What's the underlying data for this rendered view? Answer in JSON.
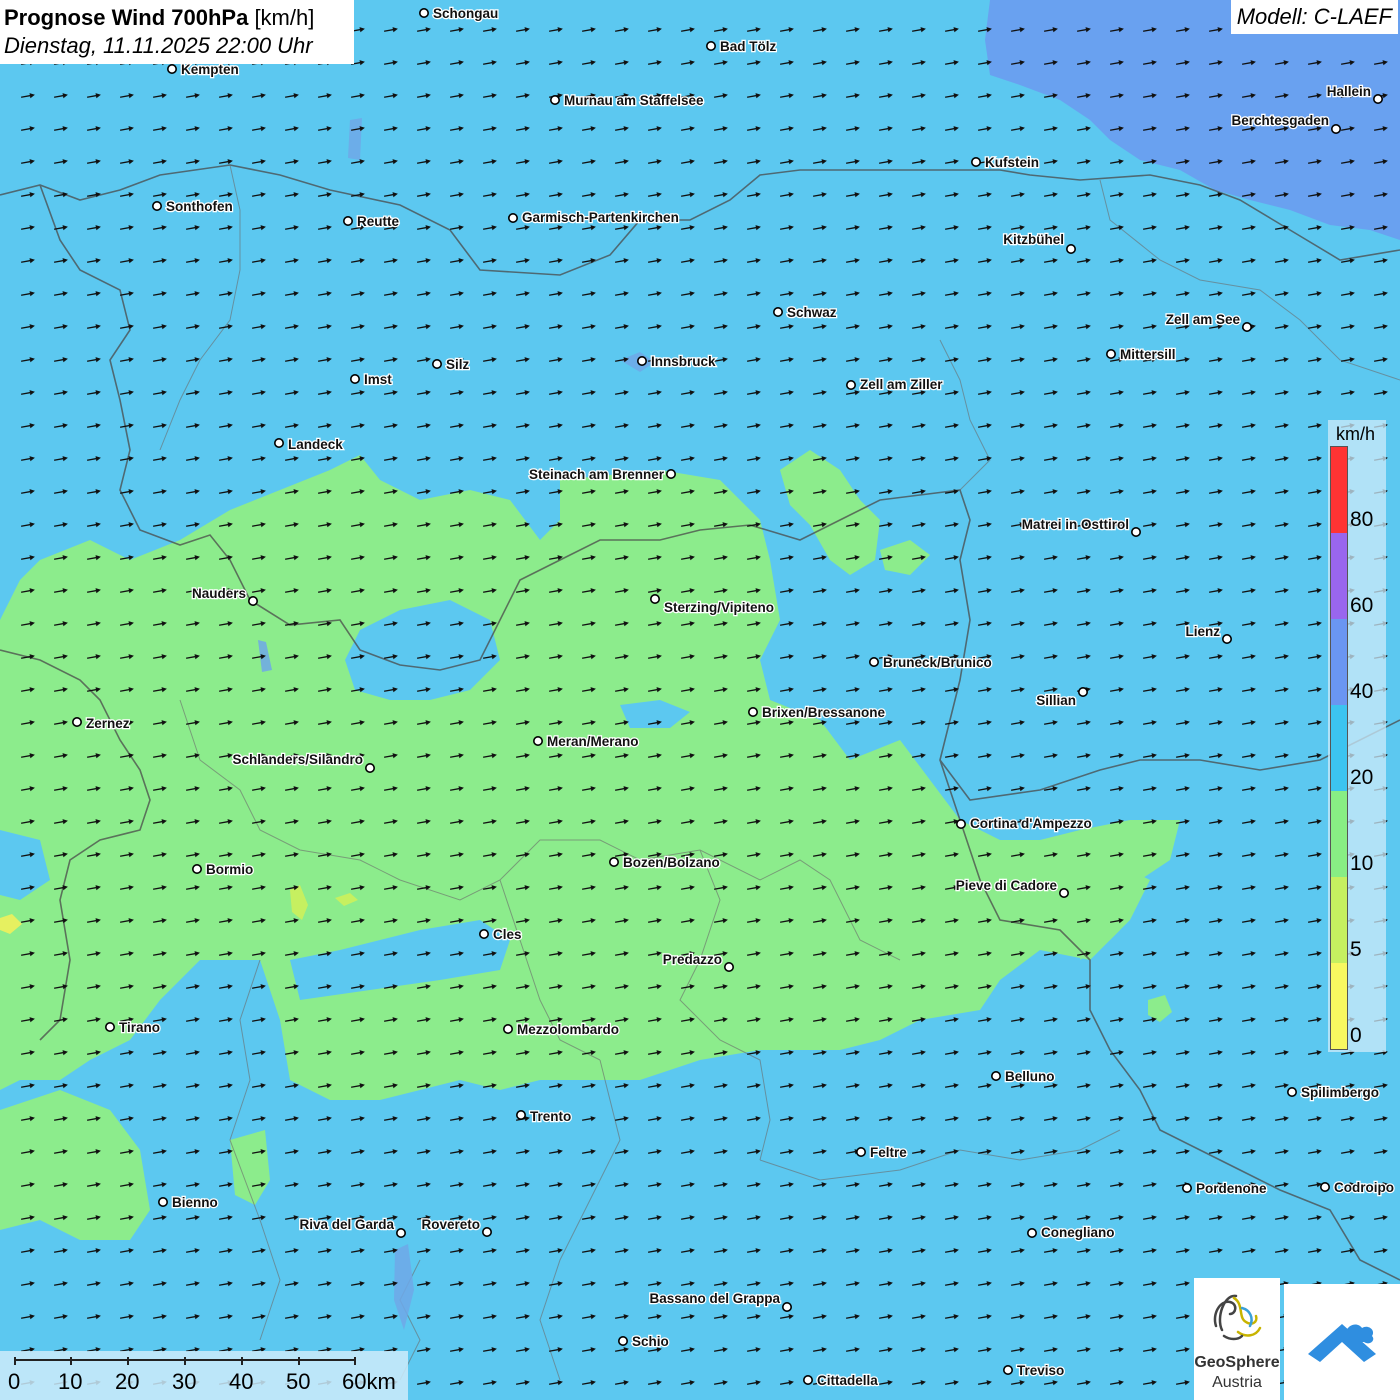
{
  "header": {
    "title_bold": "Prognose Wind 700hPa",
    "title_unit": "[km/h]",
    "datetime": "Dienstag, 11.11.2025 22:00 Uhr"
  },
  "model_label": "Modell: C-LAEF",
  "legend": {
    "unit": "km/h",
    "labels": [
      "80",
      "60",
      "40",
      "20",
      "10",
      "5",
      "0"
    ],
    "colors": {
      "band_0_5": "#f8f860",
      "band_5_10": "#c6f060",
      "band_10_20": "#88ee84",
      "band_20_40": "#3cc4f0",
      "band_40_60": "#6a96f2",
      "band_60_80": "#9966ee",
      "band_80_plus": "#ff3333"
    }
  },
  "scale_bar": {
    "labels": [
      "0",
      "10",
      "20",
      "30",
      "40",
      "50",
      "60km"
    ]
  },
  "logo": {
    "name": "GeoSphere",
    "sub": "Austria"
  },
  "wind_field": {
    "predominant_direction": "west-southwest",
    "arrow_icon": "wind-arrow-icon"
  },
  "cities": [
    {
      "name": "Schongau"
    },
    {
      "name": "Bad Tölz"
    },
    {
      "name": "Kempten"
    },
    {
      "name": "Murnau am Staffelsee"
    },
    {
      "name": "Hallein"
    },
    {
      "name": "Berchtesgaden"
    },
    {
      "name": "Kufstein"
    },
    {
      "name": "Sonthofen"
    },
    {
      "name": "Reutte"
    },
    {
      "name": "Garmisch-Partenkirchen"
    },
    {
      "name": "Kitzbühel"
    },
    {
      "name": "Schwaz"
    },
    {
      "name": "Zell am See"
    },
    {
      "name": "Mittersill"
    },
    {
      "name": "Innsbruck"
    },
    {
      "name": "Silz"
    },
    {
      "name": "Imst"
    },
    {
      "name": "Zell am Ziller"
    },
    {
      "name": "Landeck"
    },
    {
      "name": "Steinach am Brenner"
    },
    {
      "name": "Matrei in Osttirol"
    },
    {
      "name": "Nauders"
    },
    {
      "name": "Sterzing/Vipiteno"
    },
    {
      "name": "Lienz"
    },
    {
      "name": "Bruneck/Brunico"
    },
    {
      "name": "Sillian"
    },
    {
      "name": "Zernez"
    },
    {
      "name": "Brixen/Bressanone"
    },
    {
      "name": "Meran/Merano"
    },
    {
      "name": "Schlanders/Silandro"
    },
    {
      "name": "Cortina d'Ampezzo"
    },
    {
      "name": "Bormio"
    },
    {
      "name": "Bozen/Bolzano"
    },
    {
      "name": "Pieve di Cadore"
    },
    {
      "name": "Cles"
    },
    {
      "name": "Predazzo"
    },
    {
      "name": "Tirano"
    },
    {
      "name": "Mezzolombardo"
    },
    {
      "name": "Belluno"
    },
    {
      "name": "Spilimbergo"
    },
    {
      "name": "Trento"
    },
    {
      "name": "Feltre"
    },
    {
      "name": "Pordenone"
    },
    {
      "name": "Codroipo"
    },
    {
      "name": "Bienno"
    },
    {
      "name": "Riva del Garda"
    },
    {
      "name": "Rovereto"
    },
    {
      "name": "Conegliano"
    },
    {
      "name": "Bassano del Grappa"
    },
    {
      "name": "Schio"
    },
    {
      "name": "Treviso"
    },
    {
      "name": "Cittadella"
    }
  ]
}
